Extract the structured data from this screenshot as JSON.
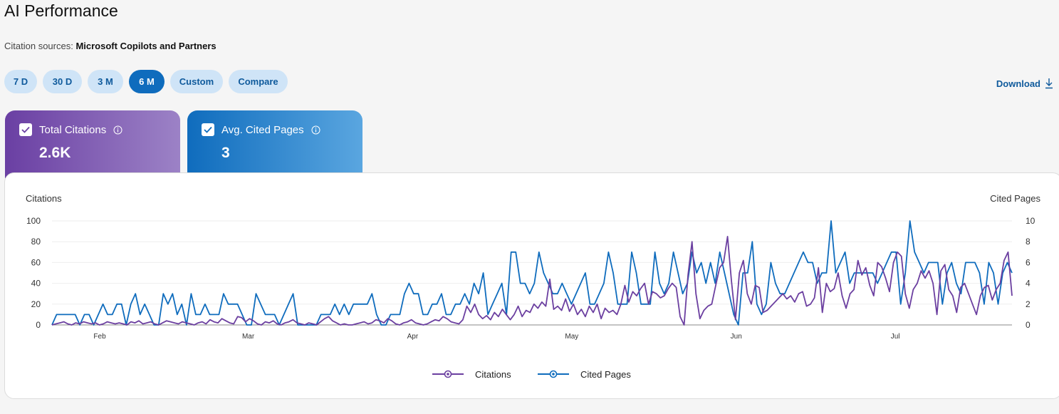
{
  "page": {
    "title": "AI Performance",
    "sources_label": "Citation sources:",
    "sources_value": "Microsoft Copilots and Partners"
  },
  "range_buttons": [
    {
      "label": "7 D",
      "active": false
    },
    {
      "label": "30 D",
      "active": false
    },
    {
      "label": "3 M",
      "active": false
    },
    {
      "label": "6 M",
      "active": true
    },
    {
      "label": "Custom",
      "active": false
    },
    {
      "label": "Compare",
      "active": false
    }
  ],
  "download_label": "Download",
  "cards": {
    "citations": {
      "label": "Total Citations",
      "value": "2.6K",
      "checked": true,
      "color": "#6a3fa3"
    },
    "pages": {
      "label": "Avg. Cited Pages",
      "value": "3",
      "checked": true,
      "color": "#0f6cbd"
    }
  },
  "icons": {
    "info": "info-icon",
    "download": "download-arrow-icon",
    "check": "checkmark-icon"
  },
  "chart_data": {
    "type": "line",
    "x_axis_type": "date",
    "x_start": "2025-01-23",
    "x_end": "2025-07-23",
    "month_ticks": [
      {
        "label": "Feb",
        "date": "2025-02-01"
      },
      {
        "label": "Mar",
        "date": "2025-03-01"
      },
      {
        "label": "Apr",
        "date": "2025-04-01"
      },
      {
        "label": "May",
        "date": "2025-05-01"
      },
      {
        "label": "Jun",
        "date": "2025-06-01"
      },
      {
        "label": "Jul",
        "date": "2025-07-01"
      }
    ],
    "y_left": {
      "label": "Citations",
      "min": 0,
      "max": 100,
      "ticks": [
        0,
        20,
        40,
        60,
        80,
        100
      ]
    },
    "y_right": {
      "label": "Cited Pages",
      "min": 0,
      "max": 10,
      "ticks": [
        0,
        2,
        4,
        6,
        8,
        10
      ]
    },
    "grid": true,
    "legend_position": "bottom-center",
    "series": [
      {
        "name": "Citations",
        "axis": "left",
        "color": "#6b3fa0",
        "values": [
          0,
          1,
          2,
          3,
          1,
          0,
          2,
          1,
          3,
          2,
          1,
          2,
          0,
          1,
          3,
          2,
          1,
          2,
          1,
          0,
          3,
          2,
          4,
          1,
          2,
          3,
          1,
          0,
          2,
          4,
          3,
          2,
          1,
          3,
          2,
          1,
          0,
          2,
          3,
          1,
          5,
          3,
          2,
          6,
          4,
          2,
          1,
          8,
          7,
          3,
          6,
          4,
          1,
          0,
          3,
          2,
          4,
          1,
          0,
          2,
          3,
          5,
          2,
          1,
          0,
          2,
          1,
          0,
          3,
          6,
          8,
          4,
          2,
          0,
          1,
          0,
          0,
          1,
          2,
          3,
          1,
          2,
          5,
          4,
          2,
          6,
          4,
          1,
          0,
          2,
          3,
          5,
          2,
          1,
          0,
          1,
          3,
          5,
          4,
          8,
          6,
          3,
          2,
          1,
          5,
          18,
          12,
          20,
          10,
          6,
          9,
          5,
          12,
          8,
          15,
          10,
          5,
          10,
          18,
          8,
          14,
          12,
          20,
          16,
          22,
          18,
          44,
          15,
          18,
          14,
          25,
          13,
          20,
          10,
          15,
          8,
          18,
          12,
          20,
          6,
          16,
          12,
          14,
          10,
          20,
          38,
          22,
          32,
          28,
          35,
          40,
          20,
          32,
          30,
          26,
          28,
          35,
          40,
          36,
          8,
          0,
          48,
          80,
          30,
          6,
          14,
          18,
          20,
          38,
          55,
          60,
          85,
          42,
          5,
          50,
          62,
          30,
          20,
          38,
          36,
          12,
          14,
          18,
          22,
          26,
          30,
          25,
          28,
          22,
          30,
          32,
          18,
          20,
          26,
          55,
          12,
          40,
          32,
          35,
          50,
          28,
          16,
          30,
          34,
          62,
          48,
          55,
          38,
          28,
          60,
          56,
          45,
          32,
          60,
          70,
          66,
          30,
          16,
          34,
          40,
          52,
          45,
          52,
          40,
          10,
          52,
          58,
          34,
          28,
          12,
          36,
          40,
          30,
          20,
          10,
          28,
          36,
          38,
          24,
          34,
          40,
          62,
          70,
          28
        ]
      },
      {
        "name": "Cited Pages",
        "axis": "right",
        "color": "#0f6cbd",
        "values": [
          0,
          1,
          1,
          1,
          1,
          1,
          0,
          1,
          1,
          0,
          1,
          2,
          1,
          1,
          2,
          2,
          0,
          2,
          3,
          1,
          2,
          1,
          0,
          0,
          3,
          2,
          3,
          1,
          2,
          0,
          3,
          1,
          1,
          2,
          1,
          1,
          1,
          3,
          2,
          2,
          2,
          1,
          0,
          0,
          3,
          2,
          1,
          1,
          1,
          0,
          1,
          2,
          3,
          0,
          0,
          0,
          0,
          0,
          1,
          1,
          1,
          2,
          1,
          2,
          1,
          2,
          2,
          2,
          2,
          3,
          1,
          0,
          0,
          1,
          1,
          1,
          3,
          4,
          3,
          3,
          1,
          1,
          2,
          2,
          3,
          1,
          1,
          2,
          2,
          3,
          2,
          4,
          3,
          5,
          1,
          2,
          3,
          4,
          1,
          7,
          7,
          4,
          4,
          3,
          4,
          7,
          5,
          4,
          3,
          3,
          4,
          3,
          2,
          3,
          4,
          5,
          2,
          2,
          3,
          4,
          7,
          5,
          2,
          2,
          2,
          7,
          5,
          2,
          2,
          2,
          7,
          4,
          3,
          4,
          7,
          5,
          3,
          4,
          7,
          5,
          6,
          4,
          6,
          4,
          7,
          5,
          3,
          1,
          0,
          5,
          5,
          8,
          2,
          1,
          2,
          6,
          4,
          3,
          3,
          4,
          5,
          6,
          7,
          6,
          6,
          4,
          5,
          5,
          10,
          5,
          6,
          7,
          4,
          5,
          5,
          5,
          5,
          5,
          4,
          5,
          6,
          7,
          7,
          2,
          5,
          10,
          7,
          6,
          5,
          6,
          6,
          6,
          2,
          5,
          6,
          4,
          3,
          6,
          6,
          6,
          5,
          2,
          6,
          5,
          2,
          5,
          6,
          5
        ]
      }
    ]
  }
}
